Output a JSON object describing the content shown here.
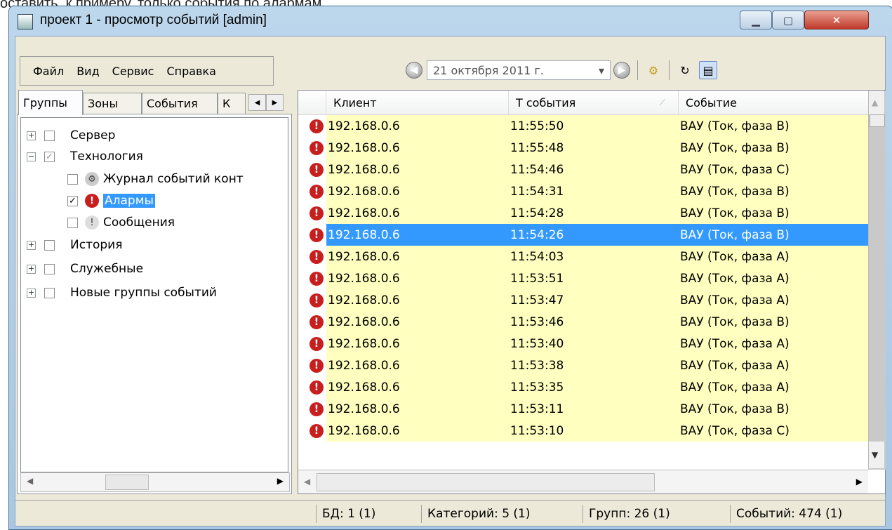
{
  "background_text": "оставить, к примеру, только события по алармам.",
  "window": {
    "title": "проект 1 - просмотр событий [admin]"
  },
  "menu": [
    {
      "label": "Файл"
    },
    {
      "label": "Вид"
    },
    {
      "label": "Сервис"
    },
    {
      "label": "Справка"
    }
  ],
  "toolbar": {
    "date": "21 октября 2011 г."
  },
  "tabs": [
    "Группы",
    "Зоны",
    "События",
    "К"
  ],
  "tree": {
    "server": "Сервер",
    "technology": "Технология",
    "journal": "Журнал событий конт",
    "alarms": "Алармы",
    "messages": "Сообщения",
    "history": "История",
    "service": "Служебные",
    "new_groups": "Новые группы событий"
  },
  "table": {
    "columns": [
      "Клиент",
      "Т события",
      "Событие"
    ],
    "rows": [
      {
        "client": "192.168.0.6",
        "time": "11:55:50",
        "event": "ВАУ (Ток, фаза В)"
      },
      {
        "client": "192.168.0.6",
        "time": "11:55:48",
        "event": "ВАУ (Ток, фаза В)"
      },
      {
        "client": "192.168.0.6",
        "time": "11:54:46",
        "event": "ВАУ (Ток, фаза С)"
      },
      {
        "client": "192.168.0.6",
        "time": "11:54:31",
        "event": "ВАУ (Ток, фаза В)"
      },
      {
        "client": "192.168.0.6",
        "time": "11:54:28",
        "event": "ВАУ (Ток, фаза В)"
      },
      {
        "client": "192.168.0.6",
        "time": "11:54:26",
        "event": "ВАУ (Ток, фаза В)",
        "selected": true
      },
      {
        "client": "192.168.0.6",
        "time": "11:54:03",
        "event": "ВАУ (Ток, фаза А)"
      },
      {
        "client": "192.168.0.6",
        "time": "11:53:51",
        "event": "ВАУ (Ток, фаза А)"
      },
      {
        "client": "192.168.0.6",
        "time": "11:53:47",
        "event": "ВАУ (Ток, фаза А)"
      },
      {
        "client": "192.168.0.6",
        "time": "11:53:46",
        "event": "ВАУ (Ток, фаза В)"
      },
      {
        "client": "192.168.0.6",
        "time": "11:53:40",
        "event": "ВАУ (Ток, фаза А)"
      },
      {
        "client": "192.168.0.6",
        "time": "11:53:38",
        "event": "ВАУ (Ток, фаза А)"
      },
      {
        "client": "192.168.0.6",
        "time": "11:53:35",
        "event": "ВАУ (Ток, фаза А)"
      },
      {
        "client": "192.168.0.6",
        "time": "11:53:11",
        "event": "ВАУ (Ток, фаза В)"
      },
      {
        "client": "192.168.0.6",
        "time": "11:53:10",
        "event": "ВАУ (Ток, фаза С)"
      }
    ]
  },
  "status": {
    "db": "БД: 1 (1)",
    "categories": "Категорий: 5 (1)",
    "groups": "Групп: 26 (1)",
    "events": "Событий: 474 (1)"
  },
  "colors": {
    "row_bg": "#ffffc0",
    "selected_bg": "#3399ff",
    "alarm_icon": "#c81e1e"
  }
}
